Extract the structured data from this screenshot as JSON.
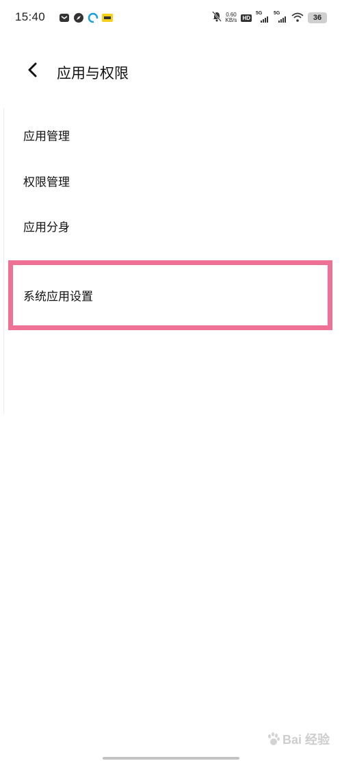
{
  "status_bar": {
    "time": "15:40",
    "speed_value": "0.60",
    "speed_unit": "KB/s",
    "hd_label": "HD",
    "sim1_net": "5G",
    "sim2_net": "5G",
    "battery": "36",
    "notif_icons": [
      "message-icon",
      "compass-icon",
      "browser-icon",
      "yellow-app-icon"
    ]
  },
  "header": {
    "title": "应用与权限"
  },
  "menu": {
    "items": [
      {
        "label": "应用管理"
      },
      {
        "label": "权限管理"
      },
      {
        "label": "应用分身"
      },
      {
        "label": "系统应用设置"
      }
    ]
  },
  "watermark": {
    "text": "Bai 经验"
  },
  "colors": {
    "highlight_border": "#ee7196",
    "background": "#ffffff",
    "text": "#111111"
  }
}
